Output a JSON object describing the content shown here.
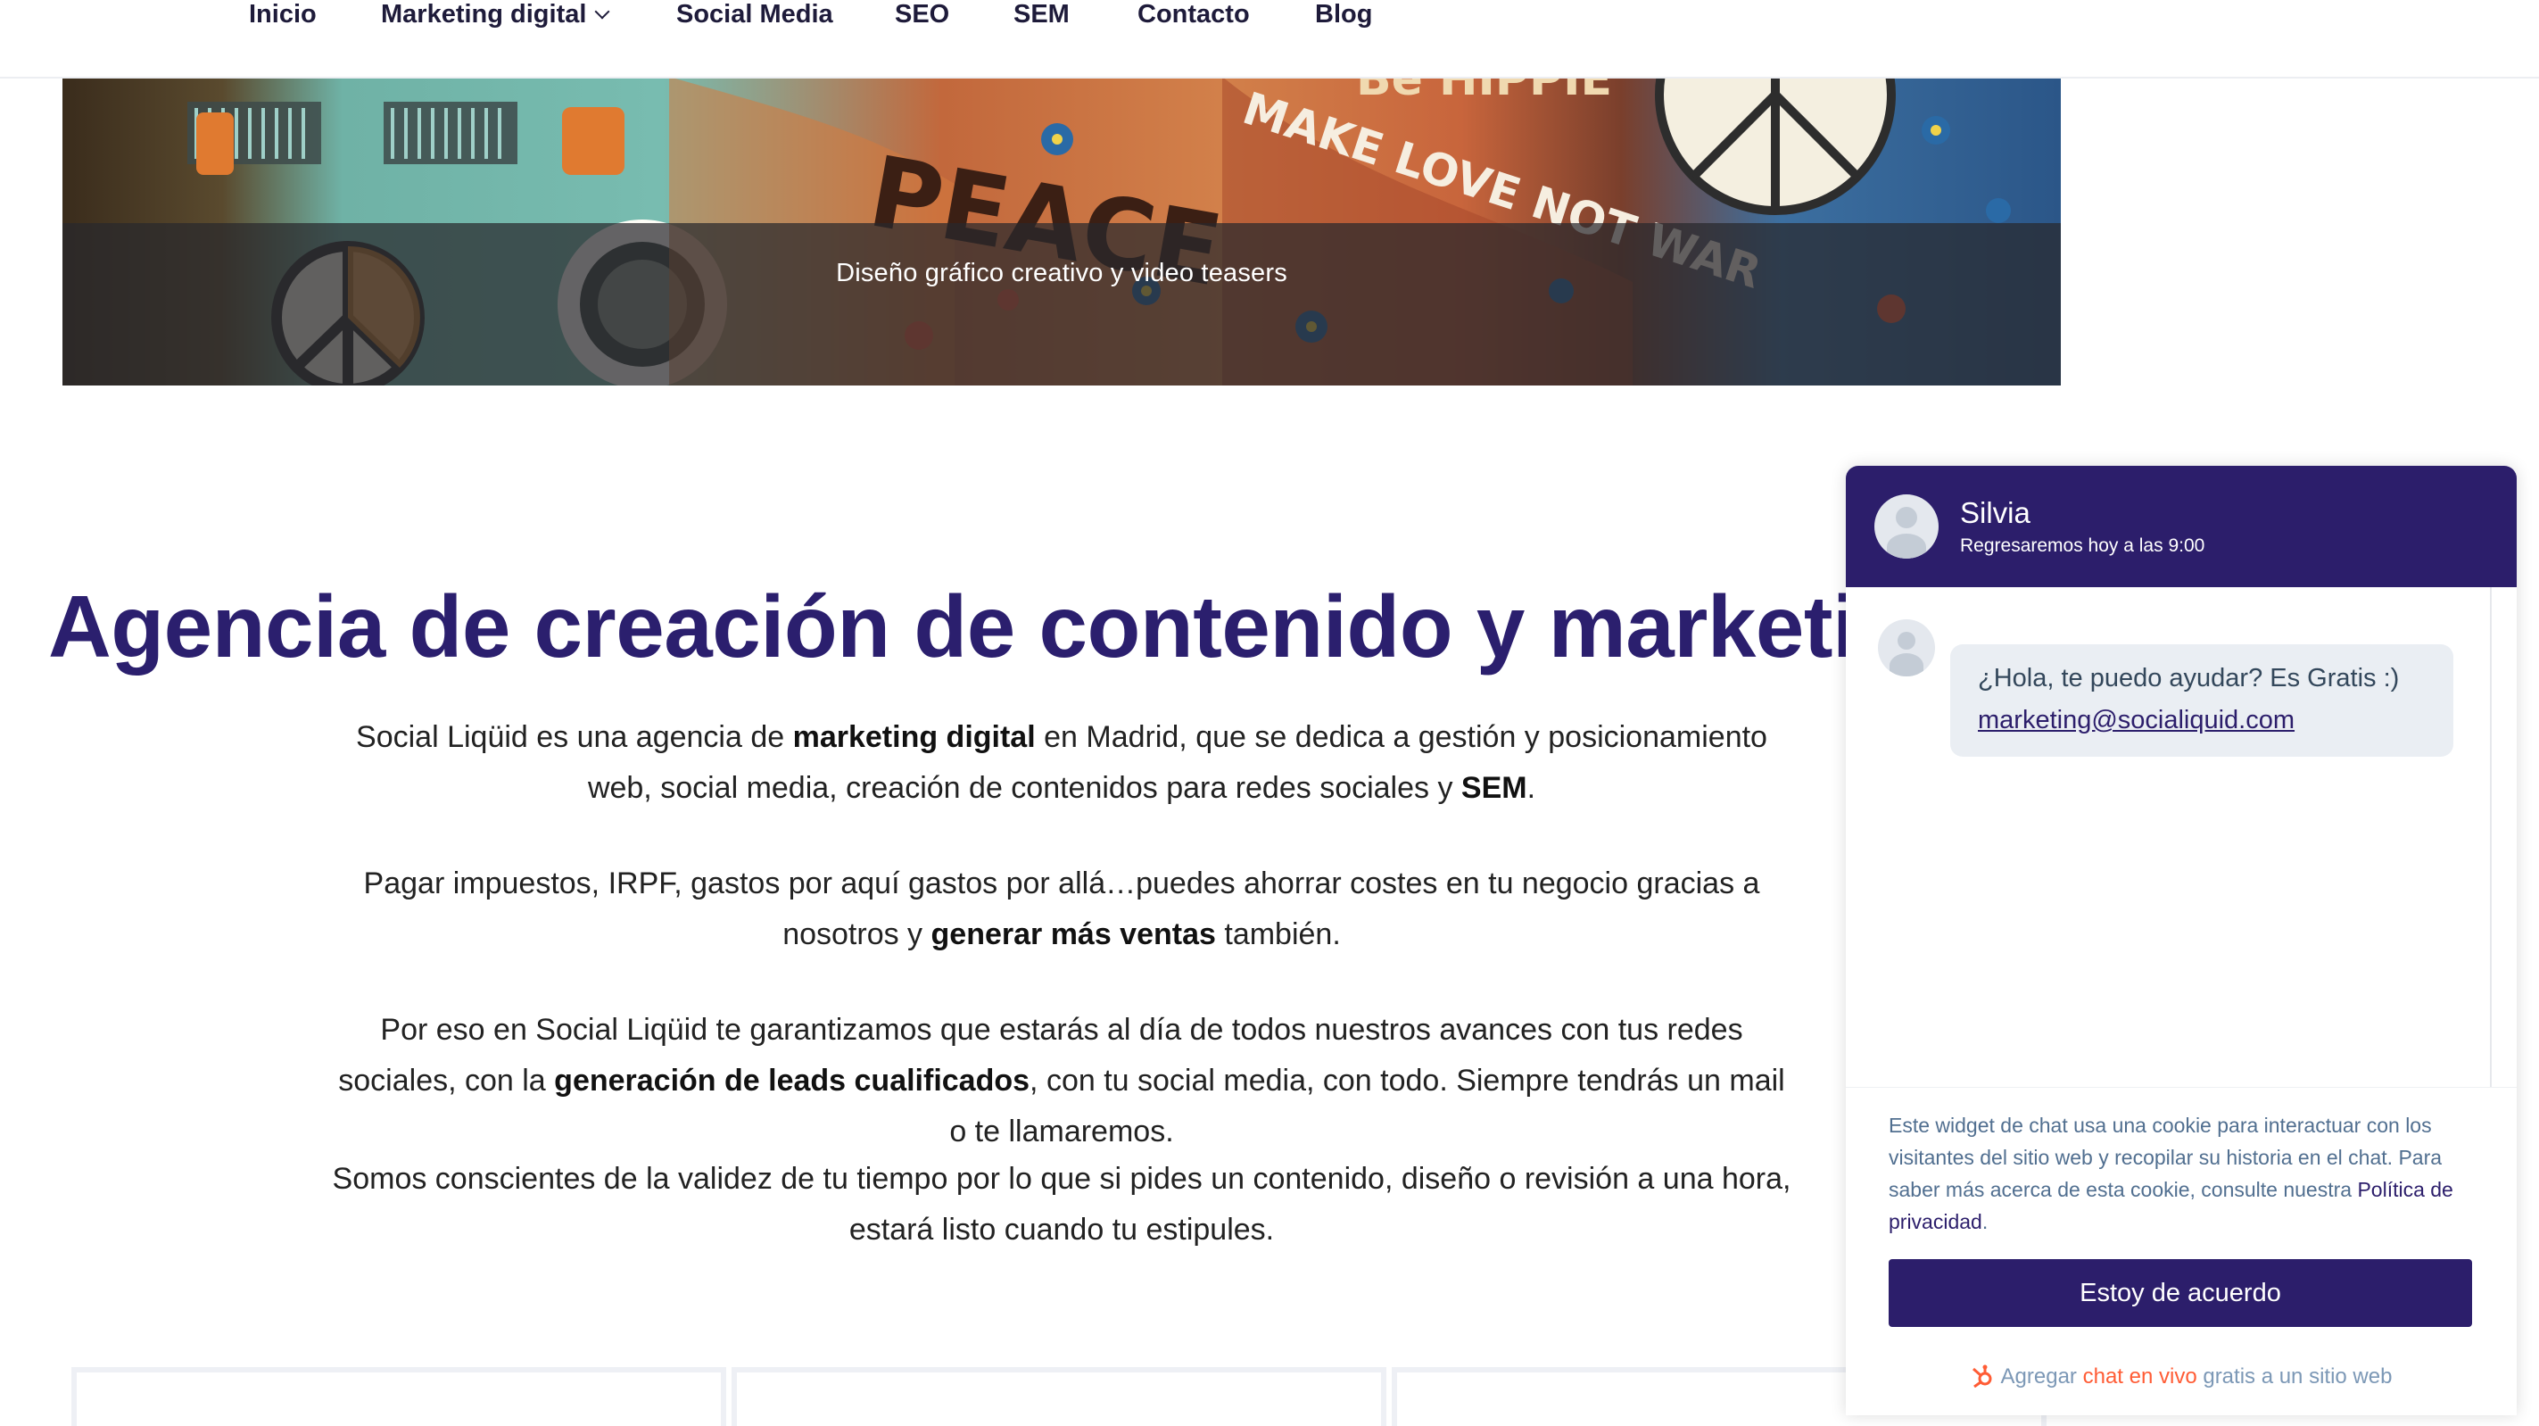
{
  "nav": {
    "items": [
      {
        "label": "Inicio"
      },
      {
        "label": "Marketing digital"
      },
      {
        "label": "Social Media"
      },
      {
        "label": "SEO"
      },
      {
        "label": "SEM"
      },
      {
        "label": "Contacto"
      },
      {
        "label": "Blog"
      }
    ]
  },
  "hero": {
    "caption": "Diseño gráfico creativo y video teasers",
    "painted_words": [
      "PEACE",
      "MAKE LOVE NOT WAR",
      "Be HIPPIE"
    ]
  },
  "main": {
    "heading": "Agencia de creación de contenido y marketing d",
    "paragraphs": [
      {
        "p1": "Social Liqüid es una agencia de ",
        "b1": "marketing digital",
        "p2": " en Madrid, que se dedica a gestión y posicionamiento web, social media, creación de contenidos para redes sociales y ",
        "b2": "SEM",
        "p3": "."
      },
      {
        "p1": "Pagar impuestos, IRPF, gastos por aquí gastos por allá…puedes ahorrar costes en tu negocio gracias a nosotros y ",
        "b1": "generar más ventas",
        "p2": " también."
      },
      {
        "p1": "Por eso en Social Liqüid te garantizamos que estarás al día de todos nuestros avances con tus redes sociales, con la ",
        "b1": "generación de leads cualificados",
        "p2": ", con tu social media, con todo. Siempre tendrás un mail o te llamaremos."
      },
      {
        "p1": "Somos conscientes de la validez de tu tiempo por lo que si pides un contenido, diseño o revisión a una hora, estará listo cuando tu estipules."
      }
    ]
  },
  "chat": {
    "agent_name": "Silvia",
    "agent_status": "Regresaremos hoy a las 9:00",
    "message": "¿Hola, te puedo ayudar? Es Gratis :)",
    "message_link": "marketing@socialiquid.com",
    "cookie_text": "Este widget de chat usa una cookie para interactuar con los visitantes del sitio web y recopilar su historia en el chat. Para saber más acerca de esta cookie, consulte nuestra ",
    "cookie_link": "Política de privacidad",
    "cookie_end": ".",
    "agree_label": "Estoy de acuerdo",
    "powered_pre": "Agregar ",
    "powered_hl": "chat en vivo",
    "powered_post": " gratis a un sitio web"
  },
  "colors": {
    "brand": "#2c1e6b",
    "heading": "#2b1f6e",
    "hubspot": "#ff5c35"
  }
}
